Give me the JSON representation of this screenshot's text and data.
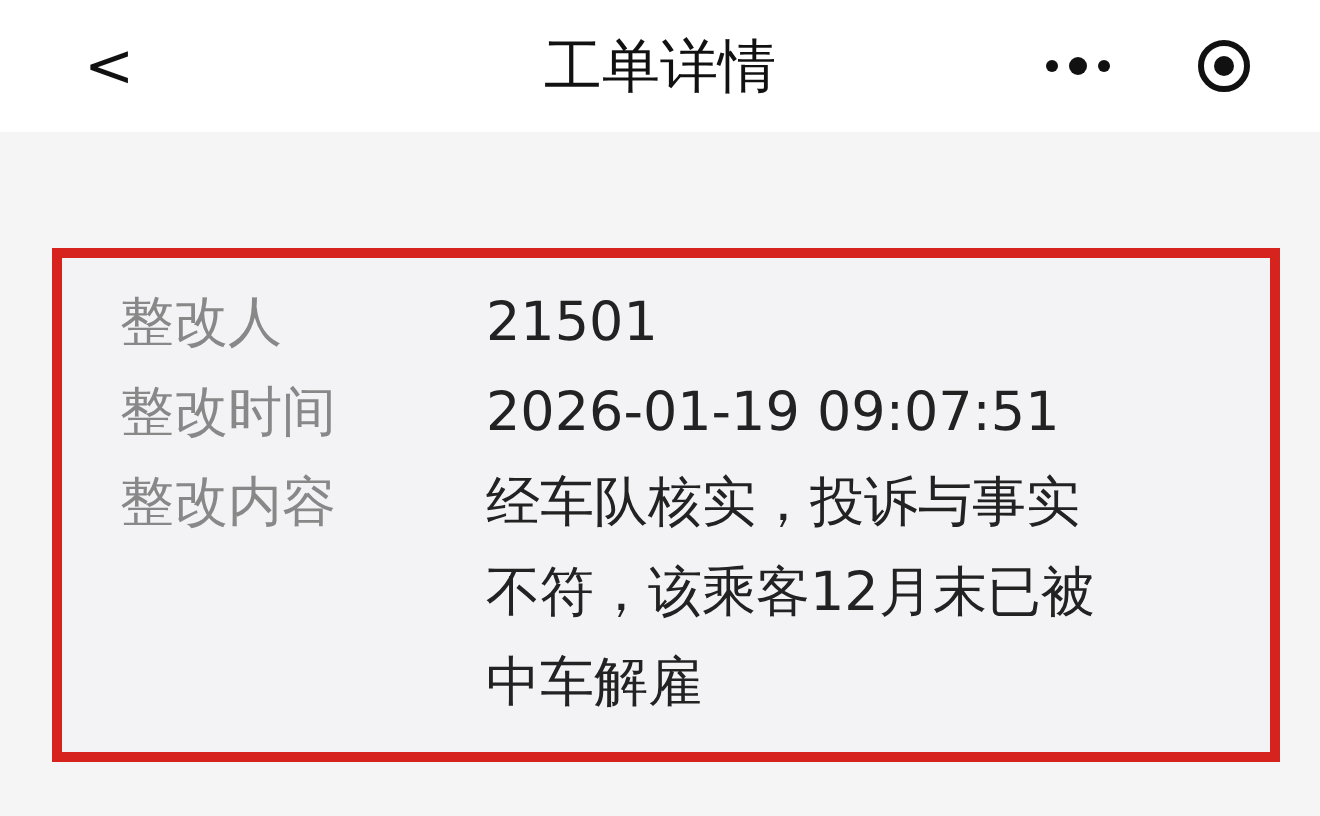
{
  "nav_bar": {
    "back_icon": "<",
    "title": "工单详情"
  },
  "detail": {
    "highlighted": true,
    "rows": [
      {
        "label": "整改人",
        "value": "21501"
      },
      {
        "label": "整改时间",
        "value": "2026-01-19 09:07:51"
      },
      {
        "label": "整改内容",
        "value": "经车队核实，投诉与事实不符，该乘客12月末已被中车解雇"
      }
    ]
  }
}
